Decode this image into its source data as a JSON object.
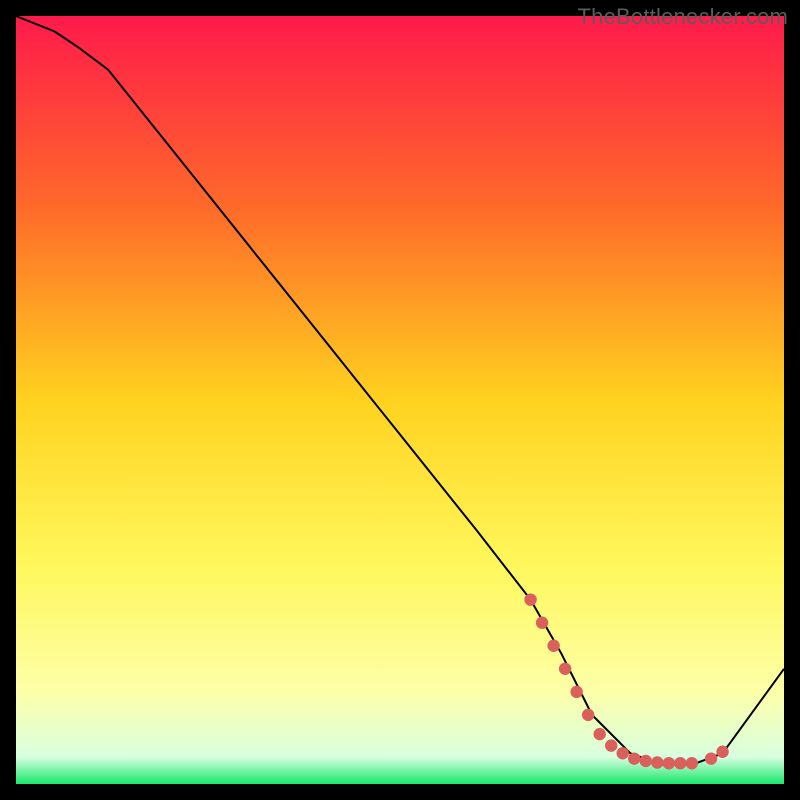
{
  "watermark": "TheBottlenecker.com",
  "chart_data": {
    "type": "line",
    "title": "",
    "xlabel": "",
    "ylabel": "",
    "xlim": [
      0,
      100
    ],
    "ylim": [
      0,
      100
    ],
    "background": {
      "gradient_stops": [
        {
          "offset": 0,
          "color": "#ff1a4b"
        },
        {
          "offset": 0.25,
          "color": "#ff6a2a"
        },
        {
          "offset": 0.5,
          "color": "#ffd21f"
        },
        {
          "offset": 0.72,
          "color": "#fff85e"
        },
        {
          "offset": 0.88,
          "color": "#fdffa8"
        },
        {
          "offset": 0.965,
          "color": "#d8ffe0"
        },
        {
          "offset": 1.0,
          "color": "#17e86b"
        }
      ]
    },
    "series": [
      {
        "name": "curve",
        "color": "#000000",
        "x": [
          0,
          5,
          8,
          12,
          20,
          30,
          40,
          50,
          60,
          67,
          71,
          75,
          80,
          84,
          88,
          92,
          100
        ],
        "y": [
          100,
          98,
          96,
          93,
          83,
          70.5,
          58,
          45.5,
          33,
          24,
          17,
          9,
          4,
          2.5,
          2.5,
          4,
          15
        ]
      }
    ],
    "markers": {
      "name": "dots",
      "color": "#d9605b",
      "radius": 6.2,
      "x": [
        67,
        68.5,
        70,
        71.5,
        73,
        74.5,
        76,
        77.5,
        79,
        80.5,
        82,
        83.5,
        85,
        86.5,
        88,
        90.5,
        92
      ],
      "y": [
        24,
        21,
        18,
        15,
        12,
        9,
        6.5,
        5,
        4,
        3.3,
        3,
        2.8,
        2.7,
        2.7,
        2.7,
        3.3,
        4.2
      ]
    }
  }
}
